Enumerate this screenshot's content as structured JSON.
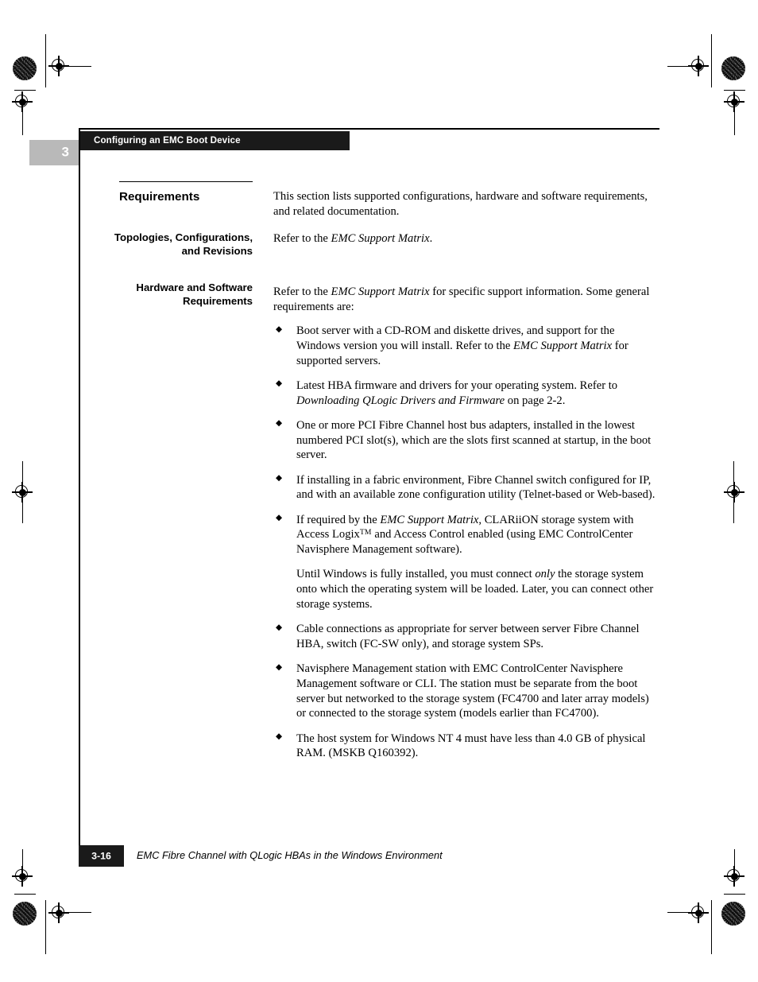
{
  "page": {
    "chapter_number": "3",
    "running_head": "Configuring an EMC Boot Device",
    "footer_page": "3-16",
    "footer_title": "EMC Fibre Channel with QLogic HBAs in the Windows Environment",
    "bullet_glyph": "◆"
  },
  "headings": {
    "requirements": "Requirements",
    "topologies": "Topologies, Configurations, and Revisions",
    "hardware_software": "Hardware and Software Requirements"
  },
  "body": {
    "intro": "This section lists supported configurations, hardware and software requirements, and related documentation.",
    "topologies_text_1": "Refer to the ",
    "topologies_italic": "EMC Support Matrix",
    "topologies_text_2": ".",
    "hardware_text_1": "Refer to the ",
    "hardware_italic": "EMC Support Matrix",
    "hardware_text_2": " for specific support information. Some general requirements are:"
  },
  "bullets": [
    {
      "part1": "Boot server with a CD-ROM and diskette drives, and support for the Windows version you will install. Refer to the ",
      "italic": "EMC Support Matrix",
      "part2": " for supported servers."
    },
    {
      "part1": "Latest HBA firmware and drivers for your operating system. Refer to ",
      "italic": "Downloading QLogic Drivers and Firmware",
      "part2": " on page 2-2."
    },
    {
      "part1": "One or more PCI Fibre Channel host bus adapters, installed in the lowest numbered PCI slot(s), which are the slots first scanned at startup, in the boot server.",
      "italic": "",
      "part2": ""
    },
    {
      "part1": "If installing in a fabric environment, Fibre Channel switch configured for IP, and with an available zone configuration utility (Telnet-based or Web-based).",
      "italic": "",
      "part2": ""
    },
    {
      "part1": "If required by the ",
      "italic": "EMC Support Matrix",
      "part2": ", CLARiiON storage system with Access Logix",
      "trademark": "TM",
      "part3": " and Access Control enabled (using EMC ControlCenter Navisphere Management software)."
    },
    {
      "part1": "Cable connections as appropriate for server between server Fibre Channel HBA, switch (FC-SW only), and storage system SPs.",
      "italic": "",
      "part2": ""
    },
    {
      "part1": "Navisphere Management station with EMC ControlCenter Navisphere Management software or CLI. The station must be separate from the boot server but networked to the storage system (FC4700 and later array models) or connected to the storage system (models earlier than FC4700).",
      "italic": "",
      "part2": ""
    },
    {
      "part1": "The host system for Windows NT 4 must have less than 4.0 GB of physical RAM. (MSKB Q160392).",
      "italic": "",
      "part2": ""
    }
  ],
  "bullet_subparagraph": {
    "part1": "Until Windows is fully installed, you must connect ",
    "italic": "only",
    "part2": " the storage system onto which the operating system will be loaded. Later, you can connect other storage systems."
  }
}
